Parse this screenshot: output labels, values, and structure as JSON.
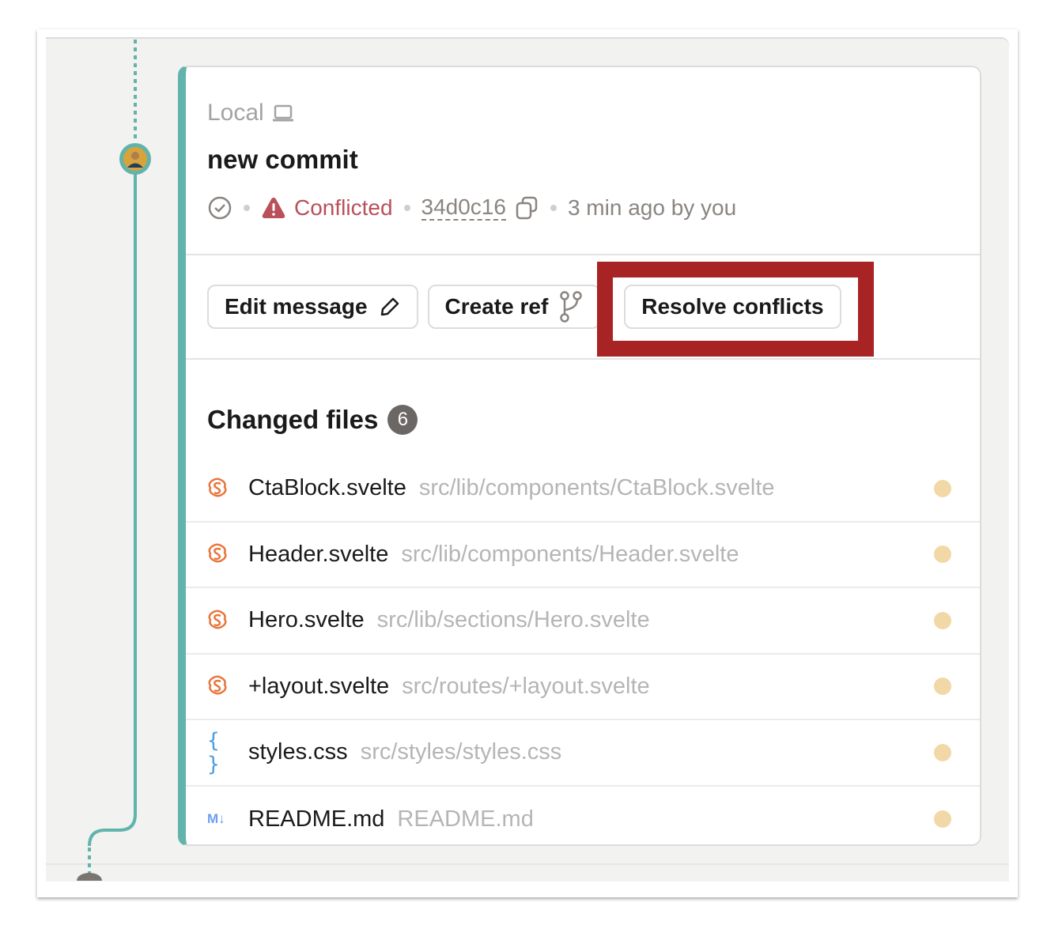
{
  "commit": {
    "location_label": "Local",
    "location_icon": "laptop-icon",
    "title": "new commit",
    "status_icon": "check-circle-icon",
    "conflict_label": "Conflicted",
    "sha": "34d0c16",
    "time": "3 min ago by you"
  },
  "actions": {
    "edit_message": "Edit message",
    "create_ref": "Create ref",
    "resolve_conflicts": "Resolve conflicts"
  },
  "changed_files": {
    "title": "Changed files",
    "count": "6",
    "files": [
      {
        "name": "CtaBlock.svelte",
        "path": "src/lib/components/CtaBlock.svelte",
        "type": "svelte"
      },
      {
        "name": "Header.svelte",
        "path": "src/lib/components/Header.svelte",
        "type": "svelte"
      },
      {
        "name": "Hero.svelte",
        "path": "src/lib/sections/Hero.svelte",
        "type": "svelte"
      },
      {
        "name": "+layout.svelte",
        "path": "src/routes/+layout.svelte",
        "type": "svelte"
      },
      {
        "name": "styles.css",
        "path": "src/styles/styles.css",
        "type": "css"
      },
      {
        "name": "README.md",
        "path": "README.md",
        "type": "markdown"
      }
    ]
  },
  "colors": {
    "lane": "#61b3ab",
    "conflict": "#b9505a",
    "highlight": "#a82424",
    "modified_dot": "#f2d8a7",
    "svelte": "#e8763e",
    "css": "#4a9de0",
    "markdown": "#6c9ef2"
  }
}
